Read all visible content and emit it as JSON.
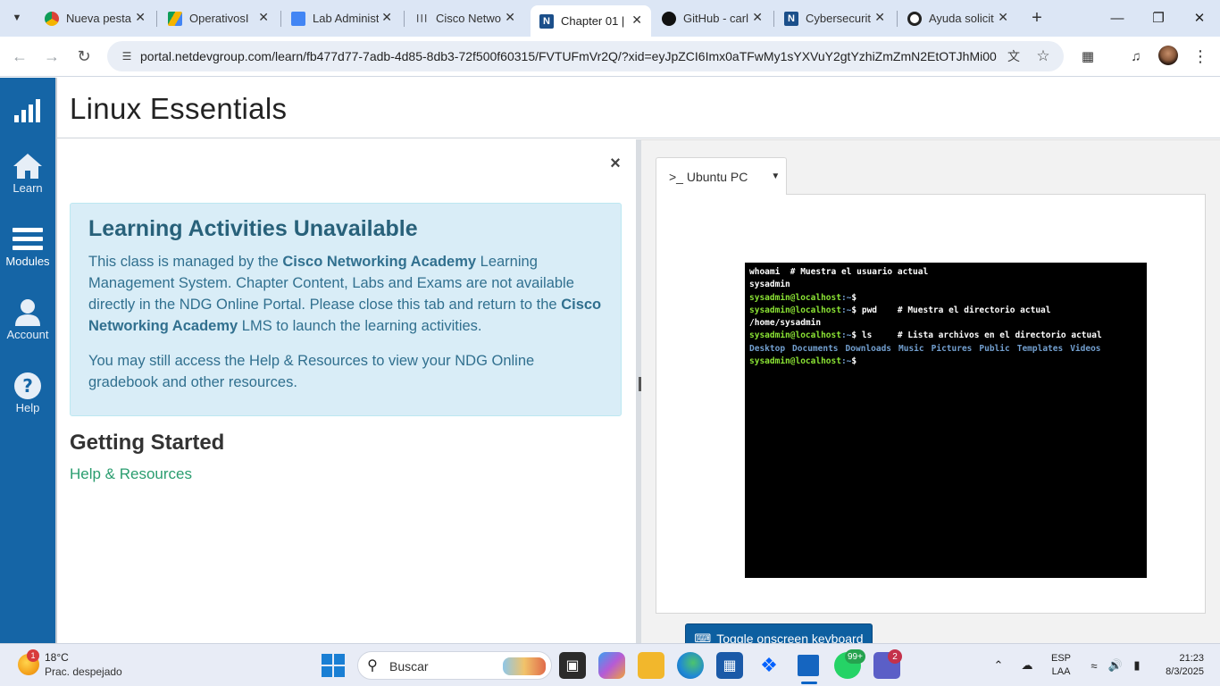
{
  "browser": {
    "tabs": [
      {
        "title": "Nueva pesta",
        "icon": "chrome-icon"
      },
      {
        "title": "OperativosI",
        "icon": "google-drive-icon"
      },
      {
        "title": "Lab Administ",
        "icon": "google-docs-icon"
      },
      {
        "title": "Cisco Netwo",
        "icon": "cisco-icon"
      },
      {
        "title": "Chapter 01 |",
        "icon": "ndg-icon",
        "active": true
      },
      {
        "title": "GitHub - carl",
        "icon": "github-icon"
      },
      {
        "title": "Cybersecurit",
        "icon": "ndg-icon"
      },
      {
        "title": "Ayuda solicit",
        "icon": "openai-icon"
      }
    ],
    "url": "portal.netdevgroup.com/learn/fb477d77-7adb-4d85-8db3-72f500f60315/FVTUFmVr2Q/?xid=eyJpZCI6Imx0aTFwMy1sYXVuY2gtYzhiZmZmN2EtOTJhMi00..."
  },
  "sidebar": {
    "items": [
      {
        "label": "",
        "icon": "signal-bars-icon"
      },
      {
        "label": "Learn",
        "icon": "home-icon"
      },
      {
        "label": "Modules",
        "icon": "modules-icon"
      },
      {
        "label": "Account",
        "icon": "user-icon"
      },
      {
        "label": "Help",
        "icon": "help-icon"
      }
    ]
  },
  "page": {
    "title": "Linux Essentials"
  },
  "notice": {
    "title": "Learning Activities Unavailable",
    "p1_a": "This class is managed by the ",
    "p1_b": "Cisco Networking Academy",
    "p1_c": " Learning Management System. Chapter Content, Labs and Exams are not available directly in the NDG Online Portal. Please close this tab and return to the ",
    "p1_d": "Cisco Networking Academy",
    "p1_e": " LMS to launch the learning activities.",
    "p2": "You may still access the Help & Resources to view your NDG Online gradebook and other resources."
  },
  "getting_started": {
    "title": "Getting Started",
    "link": "Help & Resources"
  },
  "vm": {
    "tab_label": "Ubuntu PC",
    "tab_prefix": ">_",
    "keyboard_button": "Toggle onscreen keyboard"
  },
  "terminal": {
    "user_host": "sysadmin@localhost",
    "path": ":~",
    "dollar": "$",
    "line1": "whoami  # Muestra el usuario actual",
    "line2": "sysadmin",
    "cmd3": " ",
    "cmd4": " pwd    # Muestra el directorio actual",
    "line5": "/home/sysadmin",
    "cmd6": " ls     # Lista archivos en el directorio actual",
    "dirs": [
      "Desktop",
      "Documents",
      "Downloads",
      "Music",
      "Pictures",
      "Public",
      "Templates",
      "Videos"
    ],
    "cmd8": " "
  },
  "taskbar": {
    "weather_temp": "18°C",
    "weather_cond": "Prac. despejado",
    "weather_badge": "1",
    "search_placeholder": "Buscar",
    "whatsapp_badge": "99+",
    "teams_badge": "2",
    "lang_line1": "ESP",
    "lang_line2": "LAA",
    "time": "21:23",
    "date": "8/3/2025"
  },
  "colors": {
    "sidebar": "#1565a6",
    "alert_bg": "#d9edf7",
    "link": "#2a9d6f",
    "button": "#0d5fa0",
    "terminal_prompt": "#8ae234",
    "terminal_dir": "#729fcf"
  }
}
